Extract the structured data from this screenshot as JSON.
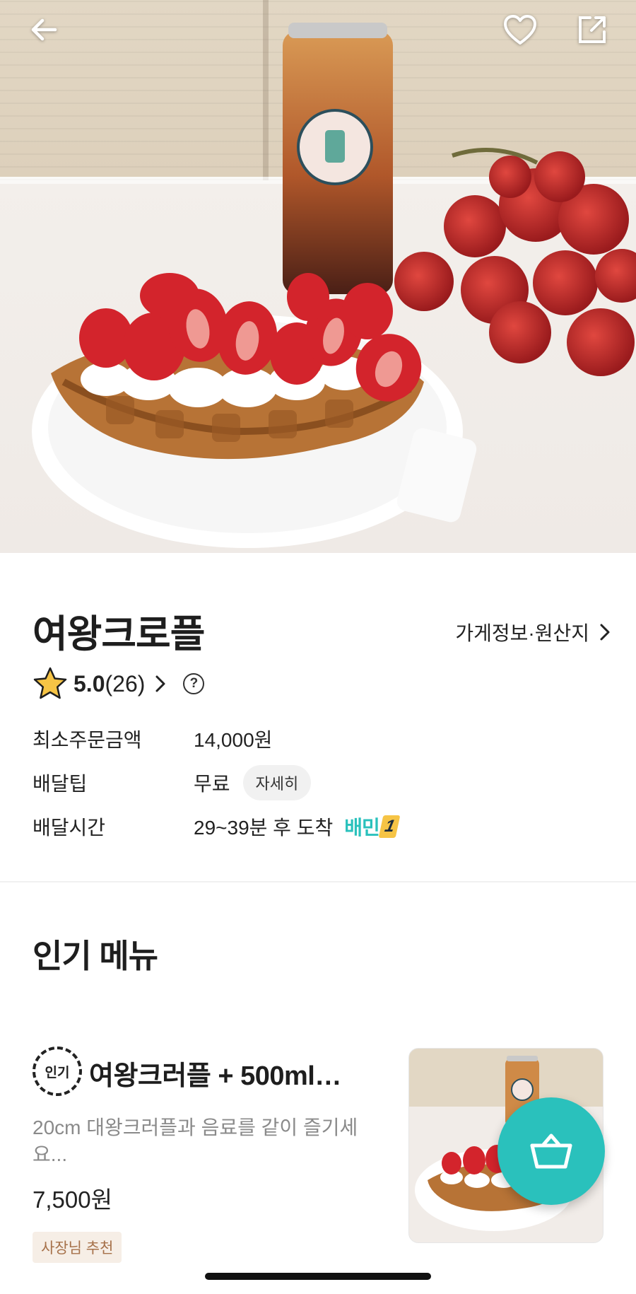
{
  "header": {
    "back_icon": "arrow-left-icon",
    "favorite_icon": "heart-outline-icon",
    "share_icon": "share-external-icon"
  },
  "store": {
    "name": "여왕크로플",
    "info_link_label": "가게정보·원산지",
    "rating": {
      "score": "5.0",
      "count": "(26)"
    },
    "min_order": {
      "label": "최소주문금액",
      "value": "14,000원"
    },
    "delivery_tip": {
      "label": "배달팁",
      "value": "무료",
      "detail_button": "자세히"
    },
    "delivery_time": {
      "label": "배달시간",
      "value": "29~39분 후 도착",
      "badge_text": "배민",
      "badge_number": "1"
    }
  },
  "popular_section": {
    "title": "인기 메뉴",
    "items": [
      {
        "badge": "인기",
        "name": "여왕크러플 + 500ml…",
        "description": "20cm 대왕크러플과 음료를 같이 즐기세요...",
        "price": "7,500원",
        "tag": "사장님 추천"
      }
    ]
  },
  "cart": {
    "icon": "basket-icon"
  },
  "colors": {
    "accent": "#2ac1bc",
    "tag_background": "#f6eee6",
    "tag_text": "#a6714a",
    "star": "#f6c445"
  }
}
